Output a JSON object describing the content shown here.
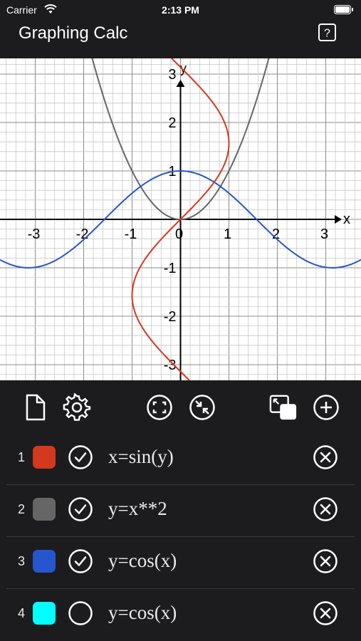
{
  "status": {
    "carrier": "Carrier",
    "time": "2:13 PM"
  },
  "header": {
    "title": "Graphing Calc"
  },
  "graph": {
    "x_ticks": [
      "-3",
      "-2",
      "-1",
      "0",
      "1",
      "2",
      "3"
    ],
    "y_ticks": [
      "3",
      "2",
      "1",
      "-1",
      "-2",
      "-3"
    ],
    "x_axis_label": "x",
    "y_axis_label": "y"
  },
  "toolbar": {
    "buttons": [
      "new-file-icon",
      "settings-gear-icon",
      "fit-view-icon",
      "shrink-view-icon",
      "overlay-icon",
      "add-icon"
    ]
  },
  "equations": [
    {
      "index": "1",
      "color": "#d4381f",
      "enabled": true,
      "expr": "x=sin(y)"
    },
    {
      "index": "2",
      "color": "#666666",
      "enabled": true,
      "expr": "y=x**2"
    },
    {
      "index": "3",
      "color": "#2655d0",
      "enabled": true,
      "expr": "y=cos(x)"
    },
    {
      "index": "4",
      "color": "#00ffff",
      "enabled": false,
      "expr": "y=cos(x)"
    }
  ]
}
